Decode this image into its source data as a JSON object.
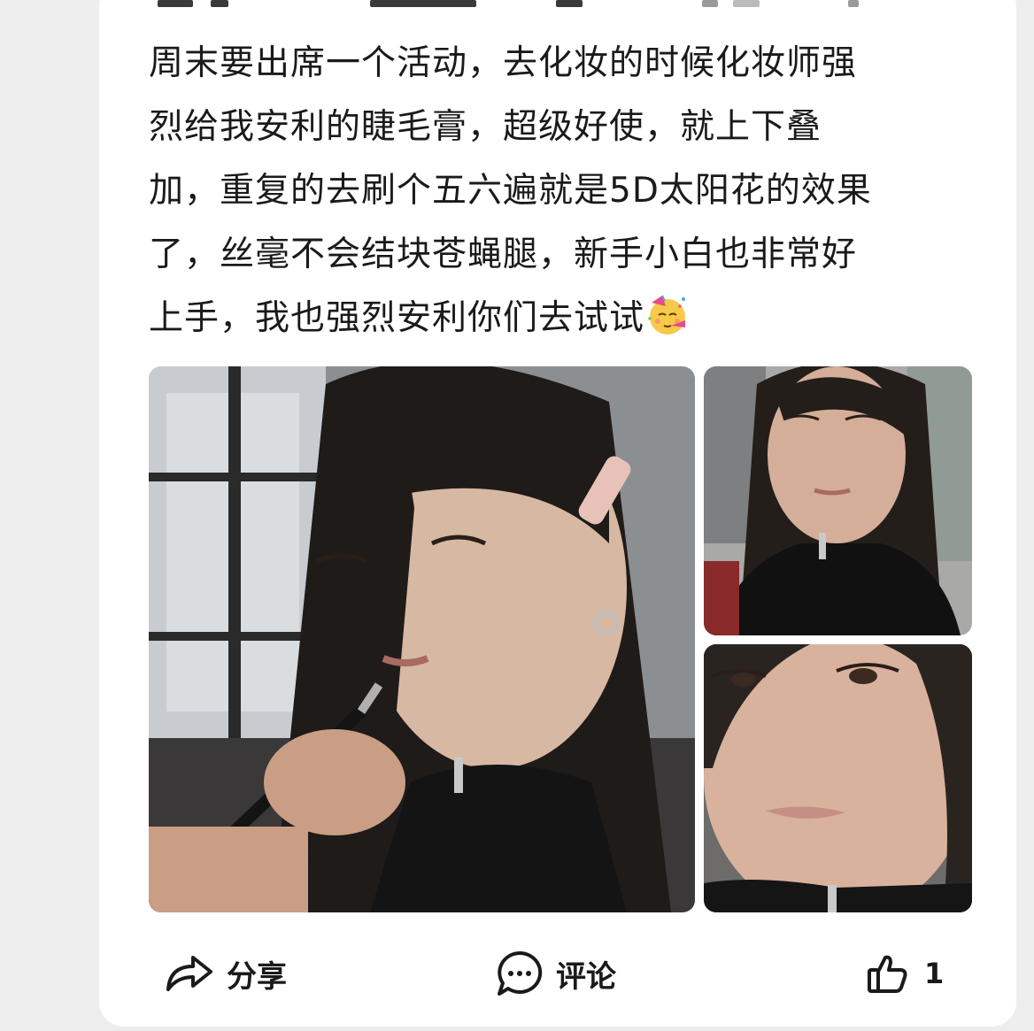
{
  "post": {
    "text_lines": [
      "周末要出席一个活动，去化妆的时候化妆师强",
      "烈给我安利的睫毛膏，超级好使，就上下叠",
      "加，重复的去刷个五六遍就是5D太阳花的效果",
      "了，丝毫不会结块苍蝇腿，新手小白也非常好",
      "上手，我也强烈安利你们去试试"
    ],
    "emoji": "partying-face-emoji"
  },
  "images": [
    {
      "name": "photo-makeup-application"
    },
    {
      "name": "photo-selfie-top"
    },
    {
      "name": "photo-closeup-bottom"
    }
  ],
  "actions": {
    "share_label": "分享",
    "comment_label": "评论",
    "like_count": "1"
  },
  "icons": {
    "share": "share-icon",
    "comment": "comment-icon",
    "like": "thumbs-up-icon"
  },
  "colors": {
    "text": "#1a1a1a",
    "card": "#ffffff",
    "background": "#eeeeee"
  }
}
